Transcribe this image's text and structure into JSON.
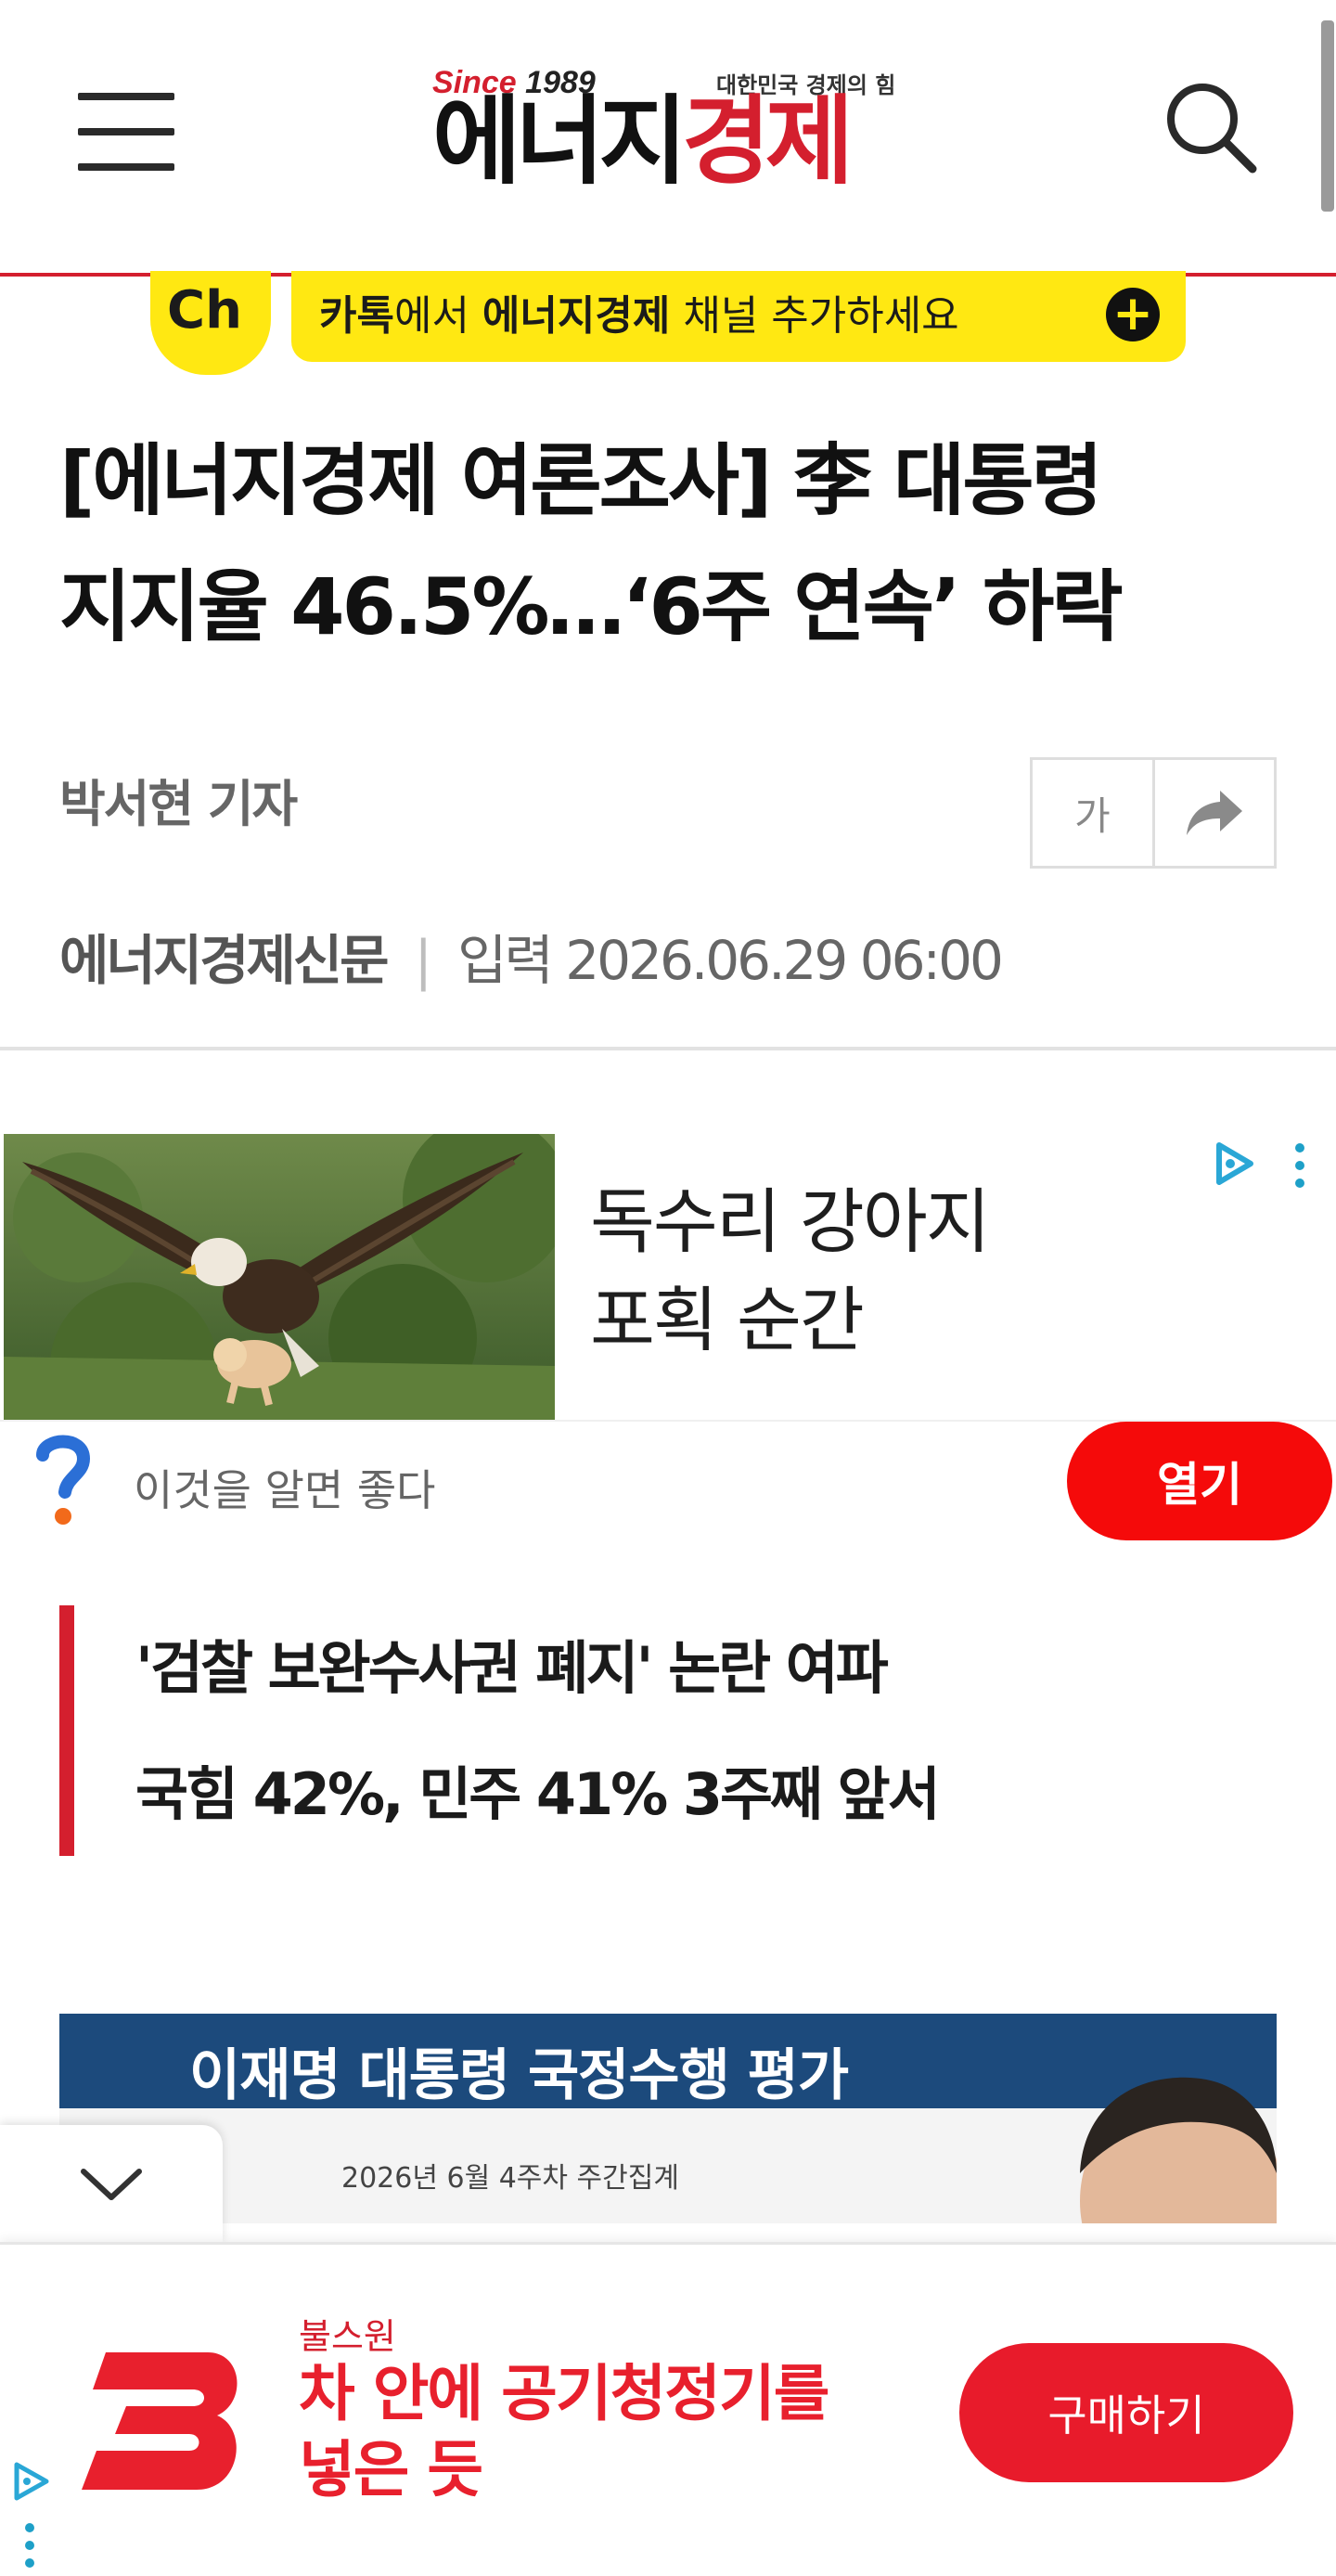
{
  "header": {
    "logo_since": "Since",
    "logo_year": "1989",
    "logo_tagline": "대한민국 경제의 힘",
    "logo_name_part1": "에너지",
    "logo_name_part2": "경제",
    "colors": {
      "brand_red": "#d41f2e"
    }
  },
  "kakao_banner": {
    "badge": "Ch",
    "text_part1": "카톡",
    "text_part2": "에서 ",
    "text_part3": "에너지경제",
    "text_part4": " 채널 추가하세요",
    "plus": "+"
  },
  "article": {
    "headline_line1": "[에너지경제 여론조사] 李 대통령",
    "headline_line2": "지지율 46.5%…‘6주 연속’ 하락",
    "author": "박서현 기자",
    "font_button": "가",
    "source": "에너지경제신문",
    "separator": "|",
    "published": "입력 2026.06.29 06:00",
    "subheads": [
      "'검찰 보완수사권 폐지' 논란 여파",
      "국힘 42%, 민주 41% 3주째 앞서"
    ],
    "image": {
      "title": "이재명 대통령 국정수행 평가",
      "subtitle": "2026년 6월 4주차 주간집계"
    }
  },
  "ad_card": {
    "title_line1": "독수리 강아지",
    "title_line2": "포획 순간",
    "source": "이것을 알면 좋다",
    "open_button": "열기",
    "open_color": "#f50a0a"
  },
  "bottom_ad": {
    "brand": "불스원",
    "headline_line1": "차 안에 공기청정기를",
    "headline_line2": "넣은 듯",
    "buy_button": "구매하기",
    "brand_color": "#e81b2b"
  }
}
